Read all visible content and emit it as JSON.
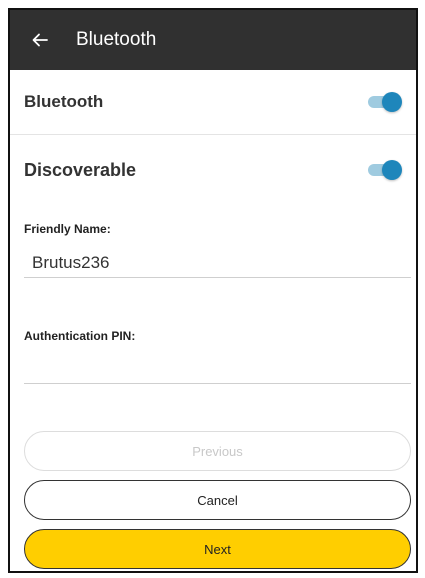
{
  "colors": {
    "appbar_bg": "#303030",
    "toggle_on_thumb": "#1e86bb",
    "toggle_on_track": "#9fcbe0",
    "next_button_bg": "#ffce00"
  },
  "appbar": {
    "back_icon": "arrow-left-icon",
    "title": "Bluetooth"
  },
  "settings": {
    "bluetooth": {
      "label": "Bluetooth",
      "enabled": true
    },
    "discoverable": {
      "label": "Discoverable",
      "enabled": true
    }
  },
  "form": {
    "friendly_name": {
      "label": "Friendly Name:",
      "value": "Brutus236"
    },
    "auth_pin": {
      "label": "Authentication PIN:",
      "value": ""
    }
  },
  "buttons": {
    "previous": {
      "label": "Previous",
      "enabled": false
    },
    "cancel": {
      "label": "Cancel"
    },
    "next": {
      "label": "Next"
    }
  }
}
